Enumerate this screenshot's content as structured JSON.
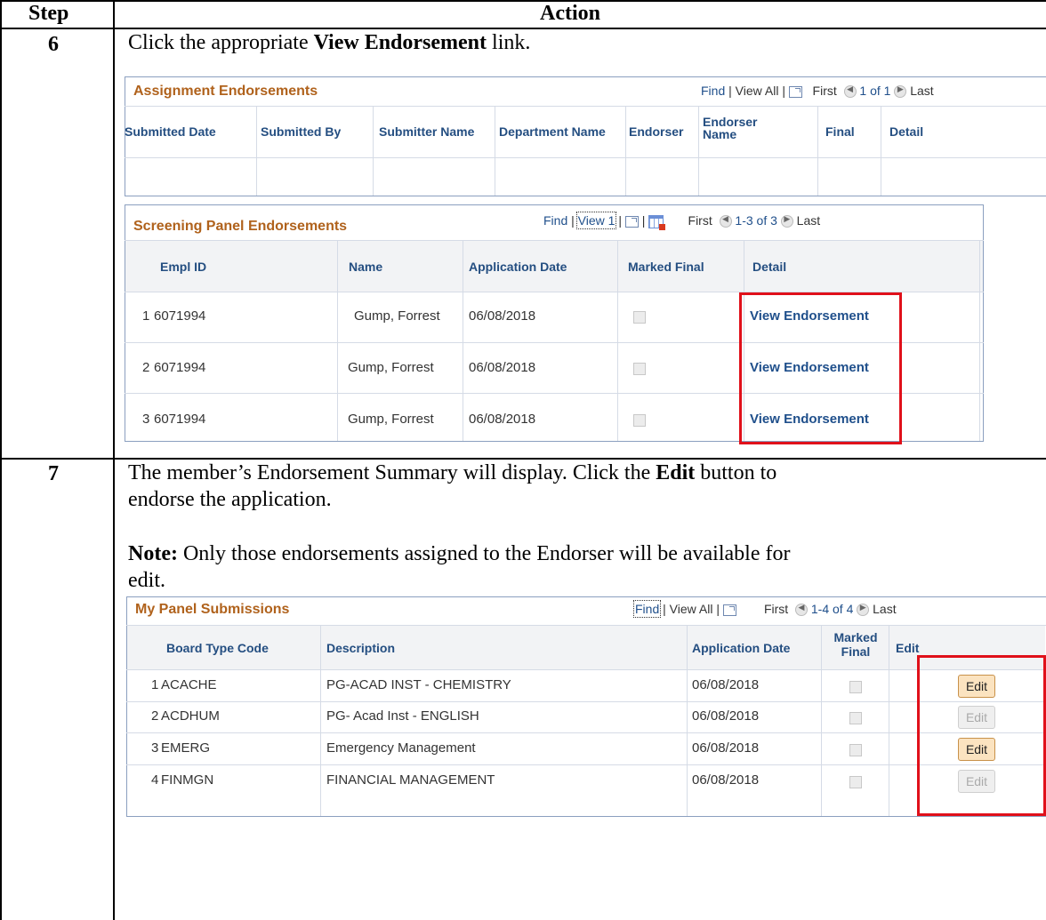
{
  "table": {
    "header_step": "Step",
    "header_action": "Action"
  },
  "step6": {
    "number": "6",
    "text_before": "Click the appropriate ",
    "text_bold": "View Endorsement",
    "text_after": " link.",
    "assignment": {
      "title": "Assignment Endorsements",
      "nav": {
        "find": "Find",
        "view_all": "View All",
        "first": "First",
        "range": "1 of 1",
        "last": "Last"
      },
      "columns": [
        "Submitted Date",
        "Submitted By",
        "Submitter Name",
        "Department Name",
        "Endorser",
        "Endorser Name",
        "Final",
        "Detail"
      ]
    },
    "screening": {
      "title": "Screening Panel Endorsements",
      "nav": {
        "find": "Find",
        "view": "View 1",
        "first": "First",
        "range": "1-3 of 3",
        "last": "Last"
      },
      "columns": [
        "Empl ID",
        "Name",
        "Application Date",
        "Marked Final",
        "Detail"
      ],
      "rows": [
        {
          "num": "1",
          "empl_id": "6071994",
          "name": "Gump, Forrest",
          "date": "06/08/2018",
          "detail": "View Endorsement"
        },
        {
          "num": "2",
          "empl_id": "6071994",
          "name": "Gump, Forrest",
          "date": "06/08/2018",
          "detail": "View Endorsement"
        },
        {
          "num": "3",
          "empl_id": "6071994",
          "name": "Gump, Forrest",
          "date": "06/08/2018",
          "detail": "View Endorsement"
        }
      ]
    }
  },
  "step7": {
    "number": "7",
    "line1_before": "The member’s Endorsement Summary will display. Click the ",
    "line1_bold": "Edit",
    "line1_after": " button to",
    "line2": "endorse the application.",
    "note_label": "Note:",
    "note_text": "  Only those endorsements assigned to the Endorser will be available for",
    "note_line2": "edit.",
    "panel": {
      "title": "My Panel Submissions",
      "nav": {
        "find": "Find",
        "view_all": "View All",
        "first": "First",
        "range": "1-4 of 4",
        "last": "Last"
      },
      "columns": [
        "Board Type Code",
        "Description",
        "Application Date",
        "Marked Final",
        "Edit"
      ],
      "rows": [
        {
          "num": "1",
          "code": "ACACHE",
          "desc": "PG-ACAD INST - CHEMISTRY",
          "date": "06/08/2018",
          "edit": "Edit",
          "enabled": true
        },
        {
          "num": "2",
          "code": "ACDHUM",
          "desc": "PG- Acad Inst - ENGLISH",
          "date": "06/08/2018",
          "edit": "Edit",
          "enabled": false
        },
        {
          "num": "3",
          "code": "EMERG",
          "desc": "Emergency Management",
          "date": "06/08/2018",
          "edit": "Edit",
          "enabled": true
        },
        {
          "num": "4",
          "code": "FINMGN",
          "desc": "FINANCIAL MANAGEMENT",
          "date": "06/08/2018",
          "edit": "Edit",
          "enabled": false
        }
      ]
    }
  },
  "colors": {
    "title": "#b0621c",
    "link": "#1f4f8b",
    "highlight": "#e0101a",
    "header": "#244e81"
  }
}
